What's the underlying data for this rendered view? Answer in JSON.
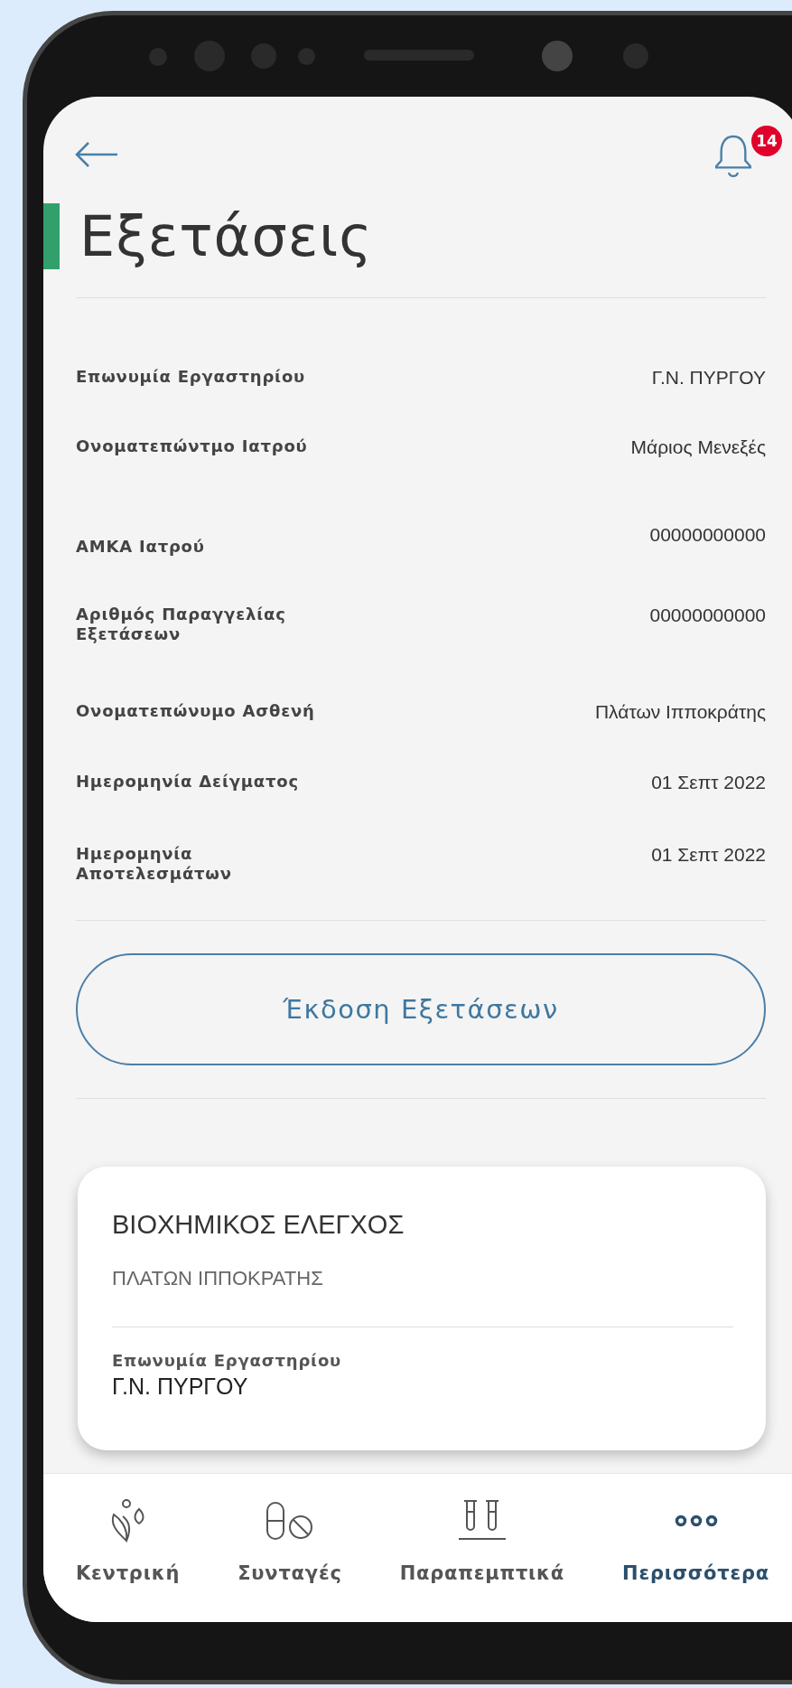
{
  "header": {
    "notification_count": "14"
  },
  "title": "Εξετάσεις",
  "details": [
    {
      "label": "Επωνυμία Εργαστηρίου",
      "value": "Γ.Ν. ΠΥΡΓΟΥ"
    },
    {
      "label": "Ονοματεπώντμο Ιατρού",
      "value": "Μάριος Μενεξές"
    },
    {
      "label": "ΑΜΚΑ Ιατρού",
      "value": "00000000000"
    },
    {
      "label": "Αριθμός Παραγγελίας Εξετάσεων",
      "value": "00000000000"
    },
    {
      "label": "Ονοματεπώνυμο Ασθενή",
      "value": "Πλάτων Ιπποκράτης"
    },
    {
      "label": "Ημερομηνία Δείγματος",
      "value": "01 Σεπτ 2022"
    },
    {
      "label": "Ημερομηνία Αποτελεσμάτων",
      "value": "01 Σεπτ 2022"
    }
  ],
  "action_button": "Έκδοση Εξετάσεων",
  "card": {
    "title": "ΒΙΟΧΗΜΙΚΟΣ ΕΛΕΓΧΟΣ",
    "subtitle": "ΠΛΑΤΩΝ ΙΠΠΟΚΡΑΤΗΣ",
    "field_label": "Επωνυμία Εργαστηρίου",
    "field_value": "Γ.Ν. ΠΥΡΓΟΥ"
  },
  "bottom_nav": [
    {
      "kind": "home",
      "label": "Κεντρική",
      "selected": false
    },
    {
      "kind": "prescriptions",
      "label": "Συνταγές",
      "selected": false
    },
    {
      "kind": "referrals",
      "label": "Παραπεμπτικά",
      "selected": false
    },
    {
      "kind": "more",
      "label": "Περισσότερα",
      "selected": true
    }
  ]
}
